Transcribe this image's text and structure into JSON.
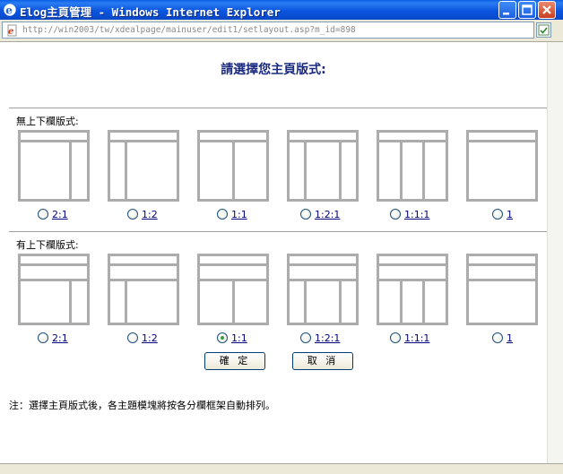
{
  "window": {
    "title": "Elog主頁管理 - Windows Internet Explorer",
    "address": "http://win2003/tw/xdealpage/mainuser/edit1/setlayout.asp?m_id=898"
  },
  "page": {
    "heading": "請選擇您主頁版式:",
    "section1_label": "無上下欄版式:",
    "section2_label": "有上下欄版式:",
    "section1_options": [
      {
        "label": "2:1",
        "icon": "layout-2-1-icon",
        "checked": false
      },
      {
        "label": "1:2",
        "icon": "layout-1-2-icon",
        "checked": false
      },
      {
        "label": "1:1",
        "icon": "layout-1-1-icon",
        "checked": false
      },
      {
        "label": "1:2:1",
        "icon": "layout-1-2-1-icon",
        "checked": false
      },
      {
        "label": "1:1:1",
        "icon": "layout-1-1-1-icon",
        "checked": false
      },
      {
        "label": "1",
        "icon": "layout-1-icon",
        "checked": false
      }
    ],
    "section2_options": [
      {
        "label": "2:1",
        "icon": "layout-header-2-1-icon",
        "checked": false
      },
      {
        "label": "1:2",
        "icon": "layout-header-1-2-icon",
        "checked": false
      },
      {
        "label": "1:1",
        "icon": "layout-header-1-1-icon",
        "checked": true
      },
      {
        "label": "1:2:1",
        "icon": "layout-header-1-2-1-icon",
        "checked": false
      },
      {
        "label": "1:1:1",
        "icon": "layout-header-1-1-1-icon",
        "checked": false
      },
      {
        "label": "1",
        "icon": "layout-header-1-icon",
        "checked": false
      }
    ],
    "confirm_label": "確 定",
    "cancel_label": "取 消",
    "note": "注：選擇主頁版式後，各主題模塊將按各分欄框架自動排列。"
  }
}
